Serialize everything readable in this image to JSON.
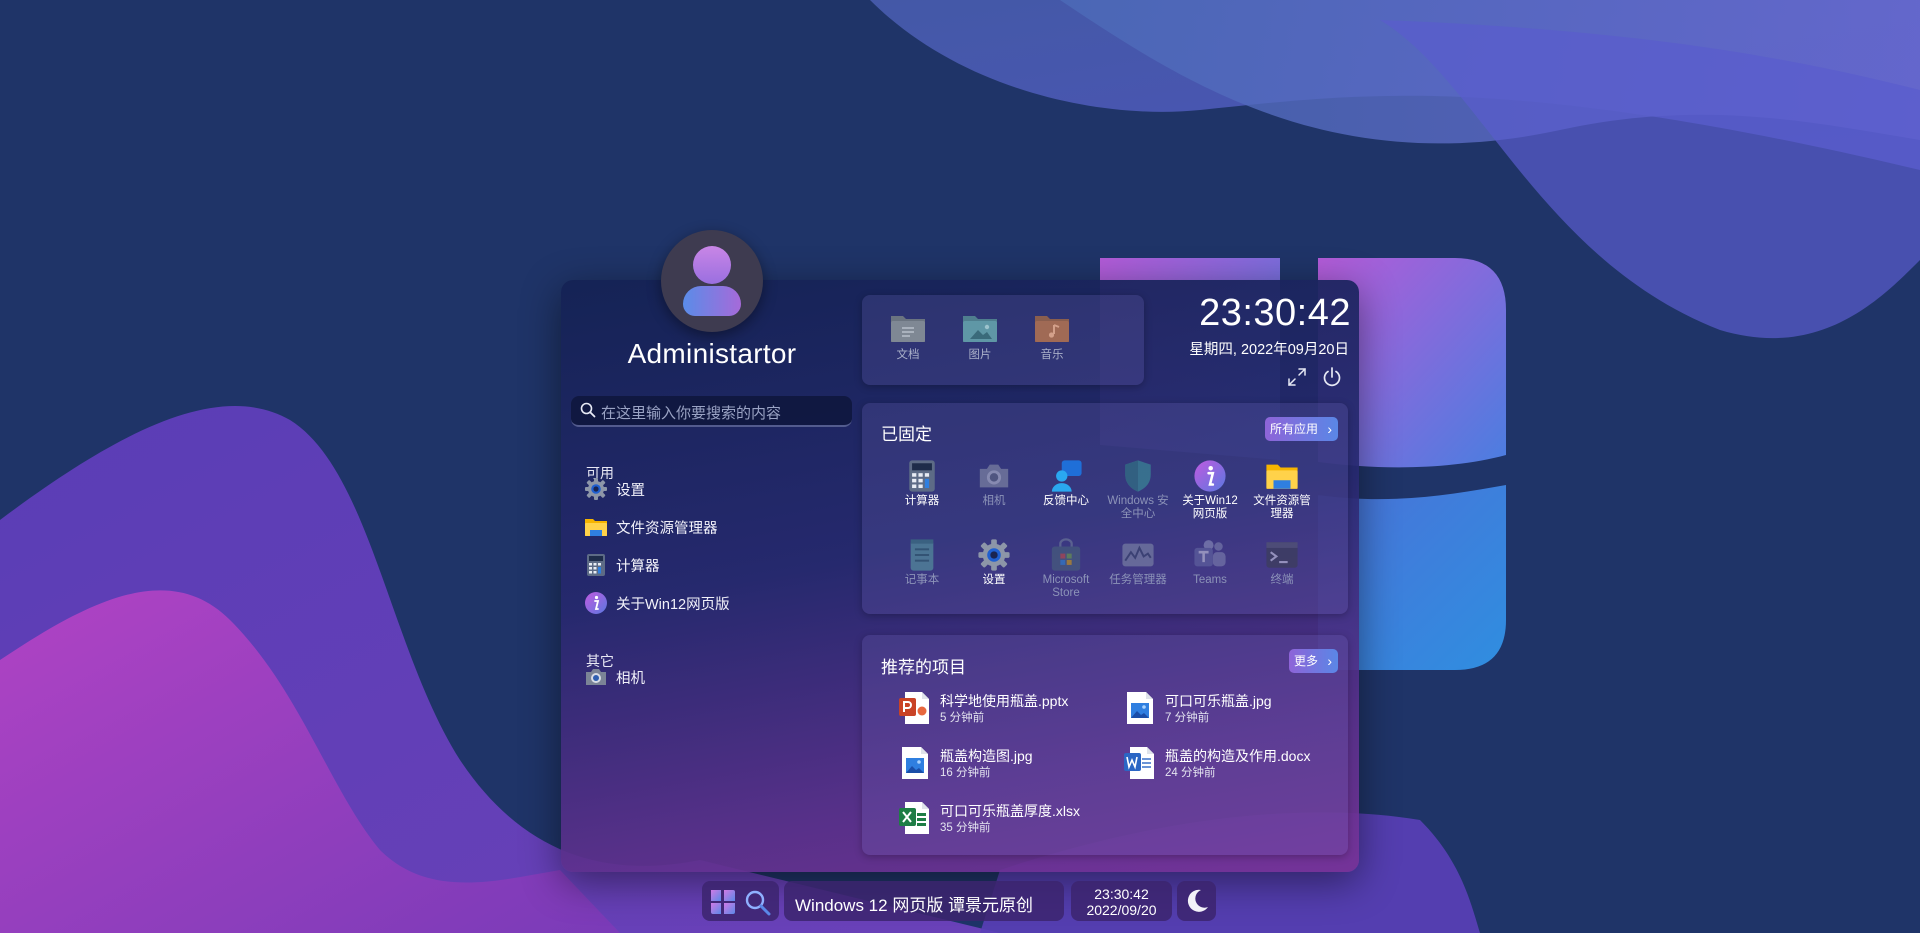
{
  "user": {
    "name": "Administartor"
  },
  "search": {
    "placeholder": "在这里输入你要搜索的内容"
  },
  "sidebar": {
    "available_title": "可用",
    "available": [
      {
        "label": "设置",
        "icon": "settings-icon"
      },
      {
        "label": "文件资源管理器",
        "icon": "file-explorer-icon"
      },
      {
        "label": "计算器",
        "icon": "calculator-icon"
      },
      {
        "label": "关于Win12网页版",
        "icon": "about-icon"
      }
    ],
    "other_title": "其它",
    "other": [
      {
        "label": "相机",
        "icon": "camera-icon"
      }
    ]
  },
  "folders": [
    {
      "label": "文档",
      "icon": "documents-folder-icon"
    },
    {
      "label": "图片",
      "icon": "pictures-folder-icon"
    },
    {
      "label": "音乐",
      "icon": "music-folder-icon"
    }
  ],
  "clock": {
    "time": "23:30:42",
    "date": "星期四, 2022年09月20日"
  },
  "pinned": {
    "title": "已固定",
    "all_apps_label": "所有应用",
    "items": [
      {
        "label": "计算器",
        "icon": "calculator-icon",
        "enabled": true
      },
      {
        "label": "相机",
        "icon": "camera-icon",
        "enabled": false
      },
      {
        "label": "反馈中心",
        "icon": "feedback-hub-icon",
        "enabled": true
      },
      {
        "label": "Windows 安全中心",
        "icon": "windows-security-icon",
        "enabled": false
      },
      {
        "label": "关于Win12网页版",
        "icon": "about-icon",
        "enabled": true
      },
      {
        "label": "文件资源管理器",
        "icon": "file-explorer-icon",
        "enabled": true
      },
      {
        "label": "记事本",
        "icon": "notepad-icon",
        "enabled": false
      },
      {
        "label": "设置",
        "icon": "settings-icon",
        "enabled": true
      },
      {
        "label": "Microsoft Store",
        "icon": "store-icon",
        "enabled": false
      },
      {
        "label": "任务管理器",
        "icon": "task-manager-icon",
        "enabled": false
      },
      {
        "label": "Teams",
        "icon": "teams-icon",
        "enabled": false
      },
      {
        "label": "终端",
        "icon": "terminal-icon",
        "enabled": false
      }
    ]
  },
  "recommended": {
    "title": "推荐的项目",
    "more_label": "更多",
    "items": [
      {
        "name": "科学地使用瓶盖.pptx",
        "time": "5 分钟前",
        "icon": "powerpoint-file-icon"
      },
      {
        "name": "可口可乐瓶盖.jpg",
        "time": "7 分钟前",
        "icon": "image-file-icon"
      },
      {
        "name": "瓶盖构造图.jpg",
        "time": "16 分钟前",
        "icon": "image-file-icon"
      },
      {
        "name": "瓶盖的构造及作用.docx",
        "time": "24 分钟前",
        "icon": "word-file-icon"
      },
      {
        "name": "可口可乐瓶盖厚度.xlsx",
        "time": "35 分钟前",
        "icon": "excel-file-icon"
      }
    ]
  },
  "taskbar": {
    "title": "Windows 12 网页版 谭景元原创",
    "time": "23:30:42",
    "date": "2022/09/20"
  },
  "colors": {
    "accent": "#8e64d8",
    "accent2": "#5a87e6",
    "desktop": "#1f3468"
  }
}
